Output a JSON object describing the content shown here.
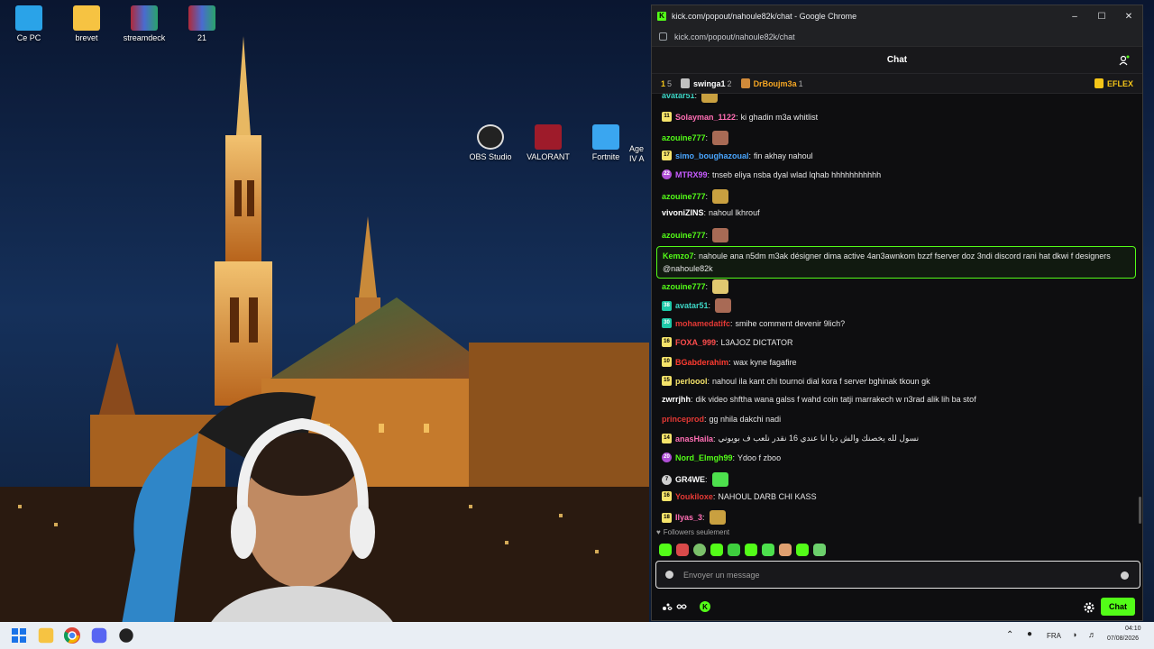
{
  "desktop": {
    "icons": [
      {
        "label": "Ce PC"
      },
      {
        "label": "brevet"
      },
      {
        "label": "streamdeck"
      },
      {
        "label": "21"
      },
      {
        "label": "OBS Studio"
      },
      {
        "label": "VALORANT"
      },
      {
        "label": "Fortnite"
      },
      {
        "label": "Age IV A"
      }
    ]
  },
  "window": {
    "title": "kick.com/popout/nahoule82k/chat - Google Chrome",
    "url": "kick.com/popout/nahoule82k/chat",
    "controls": {
      "minimize": "–",
      "maximize": "☐",
      "close": "✕"
    }
  },
  "chat": {
    "header_title": "Chat",
    "leaderboard": {
      "first_rank": "1",
      "first_count": "5",
      "users": [
        {
          "name": "swinga1",
          "count": "2",
          "color": "#ffffff"
        },
        {
          "name": "DrBoujm3a",
          "count": "1",
          "color": "#f5a623"
        }
      ],
      "right_user": "EFLEX"
    },
    "messages": [
      {
        "badge": "",
        "user": "avatar51",
        "color": "#3dd6c6",
        "text": "",
        "emote": true
      },
      {
        "badge": "11",
        "user": "Solayman_1122",
        "color": "#ff6eb4",
        "text": "ki ghadin m3a whitlist"
      },
      {
        "badge": "",
        "user": "azouine777",
        "color": "#53fc18",
        "text": "",
        "emote": true
      },
      {
        "badge": "17",
        "user": "simo_boughazoual",
        "color": "#4aa6ff",
        "text": "fin akhay nahoul"
      },
      {
        "badge": "22",
        "user": "MTRX99",
        "color": "#c75cff",
        "text": "tnseb eliya nsba dyal wlad lqhab hhhhhhhhhhh"
      },
      {
        "badge": "",
        "user": "azouine777",
        "color": "#53fc18",
        "text": "",
        "emote": true
      },
      {
        "badge": "",
        "user": "vivoniZINS",
        "color": "#ffffff",
        "text": "nahoul lkhrouf"
      },
      {
        "badge": "",
        "user": "azouine777",
        "color": "#53fc18",
        "text": "",
        "emote": true
      },
      {
        "badge": "",
        "user": "Kemzo7",
        "color": "#53fc18",
        "text": "nahoule ana n5dm m3ak désigner dima active 4an3awnkom bzzf fserver doz 3ndi discord rani hat dkwi f designers @nahoule82k"
      },
      {
        "badge": "",
        "user": "azouine777",
        "color": "#53fc18",
        "text": "",
        "emote": true
      },
      {
        "badge": "38",
        "user": "avatar51",
        "color": "#3dd6c6",
        "text": "",
        "emote": true
      },
      {
        "badge": "30",
        "user": "mohamedatifc",
        "color": "#e53935",
        "text": "smihe comment devenir 9lich?"
      },
      {
        "badge": "16",
        "user": "FOXA_999",
        "color": "#ff4d4d",
        "text": "L3AJOZ DICTATOR"
      },
      {
        "badge": "10",
        "user": "BGabderahim",
        "color": "#ff3b30",
        "text": "wax kyne fagafire"
      },
      {
        "badge": "15",
        "user": "perloool",
        "color": "#f5e36a",
        "text": "nahoul ila kant chi tournoi dial kora f server bghinak tkoun gk"
      },
      {
        "badge": "",
        "user": "zwrrjhh",
        "color": "#ffffff",
        "text": "dik video shftha wana galss f wahd coin tatji marrakech w n3rad alik lih ba stof"
      },
      {
        "badge": "",
        "user": "princeprod",
        "color": "#e53935",
        "text": "gg nhila dakchi nadi"
      },
      {
        "badge": "14",
        "user": "anasHaila",
        "color": "#ff6eb4",
        "text": "نسول لله يخصنك والش ديا انا عندي 16 نقدر نلعب ف بويوني"
      },
      {
        "badge": "20",
        "user": "Nord_Elmgh99",
        "color": "#53fc18",
        "text": "Ydoo f zboo"
      },
      {
        "badge": "7",
        "user": "GR4WE",
        "color": "#ffffff",
        "text": "",
        "emote": true
      },
      {
        "badge": "16",
        "user": "Youkiloxe",
        "color": "#e53935",
        "text": "NAHOUL DARB CHI KASS"
      },
      {
        "badge": "18",
        "user": "Ilyas_3",
        "color": "#ff6eb4",
        "text": "",
        "emote": true
      }
    ],
    "followers_only": "Followers seulement",
    "input_placeholder": "Envoyer un message",
    "send_label": "Chat"
  },
  "taskbar": {
    "language": "FRA",
    "time": "04:10",
    "date": "07/08/2026"
  }
}
